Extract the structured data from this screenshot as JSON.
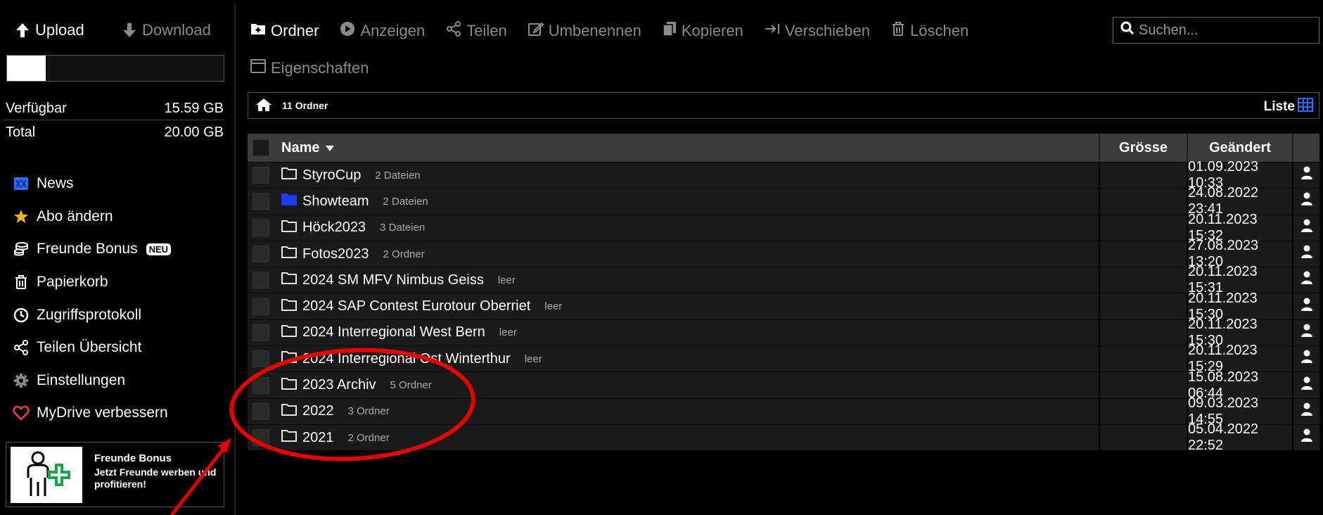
{
  "sidebar": {
    "upload_label": "Upload",
    "download_label": "Download",
    "quota_used_fraction": 0.18,
    "available_label": "Verfügbar",
    "available_value": "15.59 GB",
    "total_label": "Total",
    "total_value": "20.00 GB",
    "nav": [
      {
        "label": "News",
        "icon": "news-icon"
      },
      {
        "label": "Abo ändern",
        "icon": "star-icon"
      },
      {
        "label": "Freunde Bonus",
        "icon": "coins-icon",
        "badge": "NEU"
      },
      {
        "label": "Papierkorb",
        "icon": "trash-icon"
      },
      {
        "label": "Zugriffsprotokoll",
        "icon": "clock-icon"
      },
      {
        "label": "Teilen Übersicht",
        "icon": "share-icon"
      },
      {
        "label": "Einstellungen",
        "icon": "gear-icon"
      },
      {
        "label": "MyDrive verbessern",
        "icon": "heart-icon"
      }
    ],
    "promo": {
      "title": "Freunde Bonus",
      "text": "Jetzt Freunde werben und profitieren!"
    }
  },
  "toolbar": {
    "items": [
      {
        "label": "Ordner",
        "icon": "folder-plus-icon",
        "active": true
      },
      {
        "label": "Anzeigen",
        "icon": "play-circle-icon",
        "active": false
      },
      {
        "label": "Teilen",
        "icon": "share-icon",
        "active": false
      },
      {
        "label": "Umbenennen",
        "icon": "edit-icon",
        "active": false
      },
      {
        "label": "Kopieren",
        "icon": "copy-icon",
        "active": false
      },
      {
        "label": "Verschieben",
        "icon": "move-icon",
        "active": false
      },
      {
        "label": "Löschen",
        "icon": "trash-icon",
        "active": false
      }
    ],
    "properties_label": "Eigenschaften"
  },
  "search": {
    "placeholder": "Suchen..."
  },
  "breadcrumb": {
    "summary": "11 Ordner",
    "view_label": "Liste"
  },
  "table": {
    "headers": {
      "name": "Name",
      "size": "Grösse",
      "date": "Geändert"
    },
    "rows": [
      {
        "name": "StyroCup",
        "meta": "2 Dateien",
        "size": "",
        "date": "01.09.2023 10:33",
        "shared": false
      },
      {
        "name": "Showteam",
        "meta": "2 Dateien",
        "size": "",
        "date": "24.08.2022 23:41",
        "shared": true
      },
      {
        "name": "Höck2023",
        "meta": "3 Dateien",
        "size": "",
        "date": "20.11.2023 15:32",
        "shared": false
      },
      {
        "name": "Fotos2023",
        "meta": "2 Ordner",
        "size": "",
        "date": "27.08.2023 13:20",
        "shared": false
      },
      {
        "name": "2024 SM MFV Nimbus Geiss",
        "meta": "leer",
        "size": "",
        "date": "20.11.2023 15:31",
        "shared": false
      },
      {
        "name": "2024 SAP Contest Eurotour Oberriet",
        "meta": "leer",
        "size": "",
        "date": "20.11.2023 15:30",
        "shared": false
      },
      {
        "name": "2024 Interregional West Bern",
        "meta": "leer",
        "size": "",
        "date": "20.11.2023 15:30",
        "shared": false
      },
      {
        "name": "2024 Interregional Ost Winterthur",
        "meta": "leer",
        "size": "",
        "date": "20.11.2023 15:29",
        "shared": false
      },
      {
        "name": "2023 Archiv",
        "meta": "5 Ordner",
        "size": "",
        "date": "15.08.2023 06:44",
        "shared": false
      },
      {
        "name": "2022",
        "meta": "3 Ordner",
        "size": "",
        "date": "09.03.2023 14:55",
        "shared": false
      },
      {
        "name": "2021",
        "meta": "2 Ordner",
        "size": "",
        "date": "05.04.2022 22:52",
        "shared": false
      }
    ]
  },
  "colors": {
    "accent_blue": "#2f6bff",
    "annotation_red": "#e60000",
    "disabled_gray": "#8a8a8a",
    "heart_red": "#ff3b3b",
    "star_yellow": "#f5b800"
  }
}
